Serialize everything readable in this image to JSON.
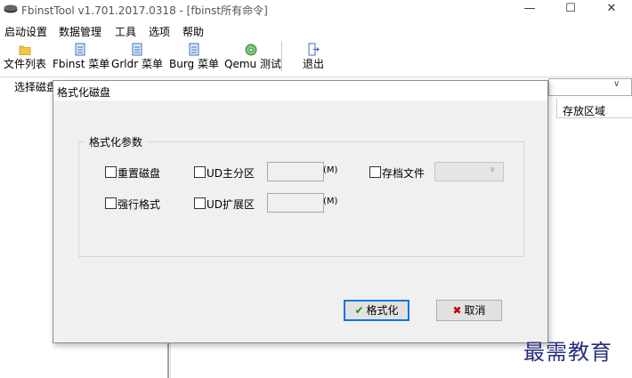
{
  "window": {
    "title": "FbinstTool v1.701.2017.0318 - [fbinst所有命令]",
    "minimize": "—",
    "maximize": "☐",
    "close": "✕"
  },
  "menu": [
    "启动设置",
    "数据管理",
    "工具",
    "选项",
    "帮助"
  ],
  "toolbar": {
    "file_list": "文件列表",
    "fbinst_menu": "Fbinst 菜单",
    "grldr_menu": "Grldr 菜单",
    "burg_menu": "Burg 菜单",
    "qemu_test": "Qemu 测试",
    "exit": "退出"
  },
  "diskbar": {
    "label": "选择磁盘"
  },
  "list": {
    "column_storage": "存放区域"
  },
  "dialog": {
    "title": "格式化磁盘",
    "group_title": "格式化参数",
    "reset_disk": "重置磁盘",
    "force_format": "强行格式",
    "ud_primary": "UD主分区",
    "ud_extended": "UD扩展区",
    "unit_primary": "(M)",
    "unit_extended": "(M)",
    "archive_file": "存档文件",
    "format_button": "格式化",
    "cancel_button": "取消"
  },
  "watermark": "最需教育",
  "colors": {
    "watermark": "#2a2e7c",
    "format_icon": "#1e8a1e",
    "cancel_icon": "#c00000"
  }
}
